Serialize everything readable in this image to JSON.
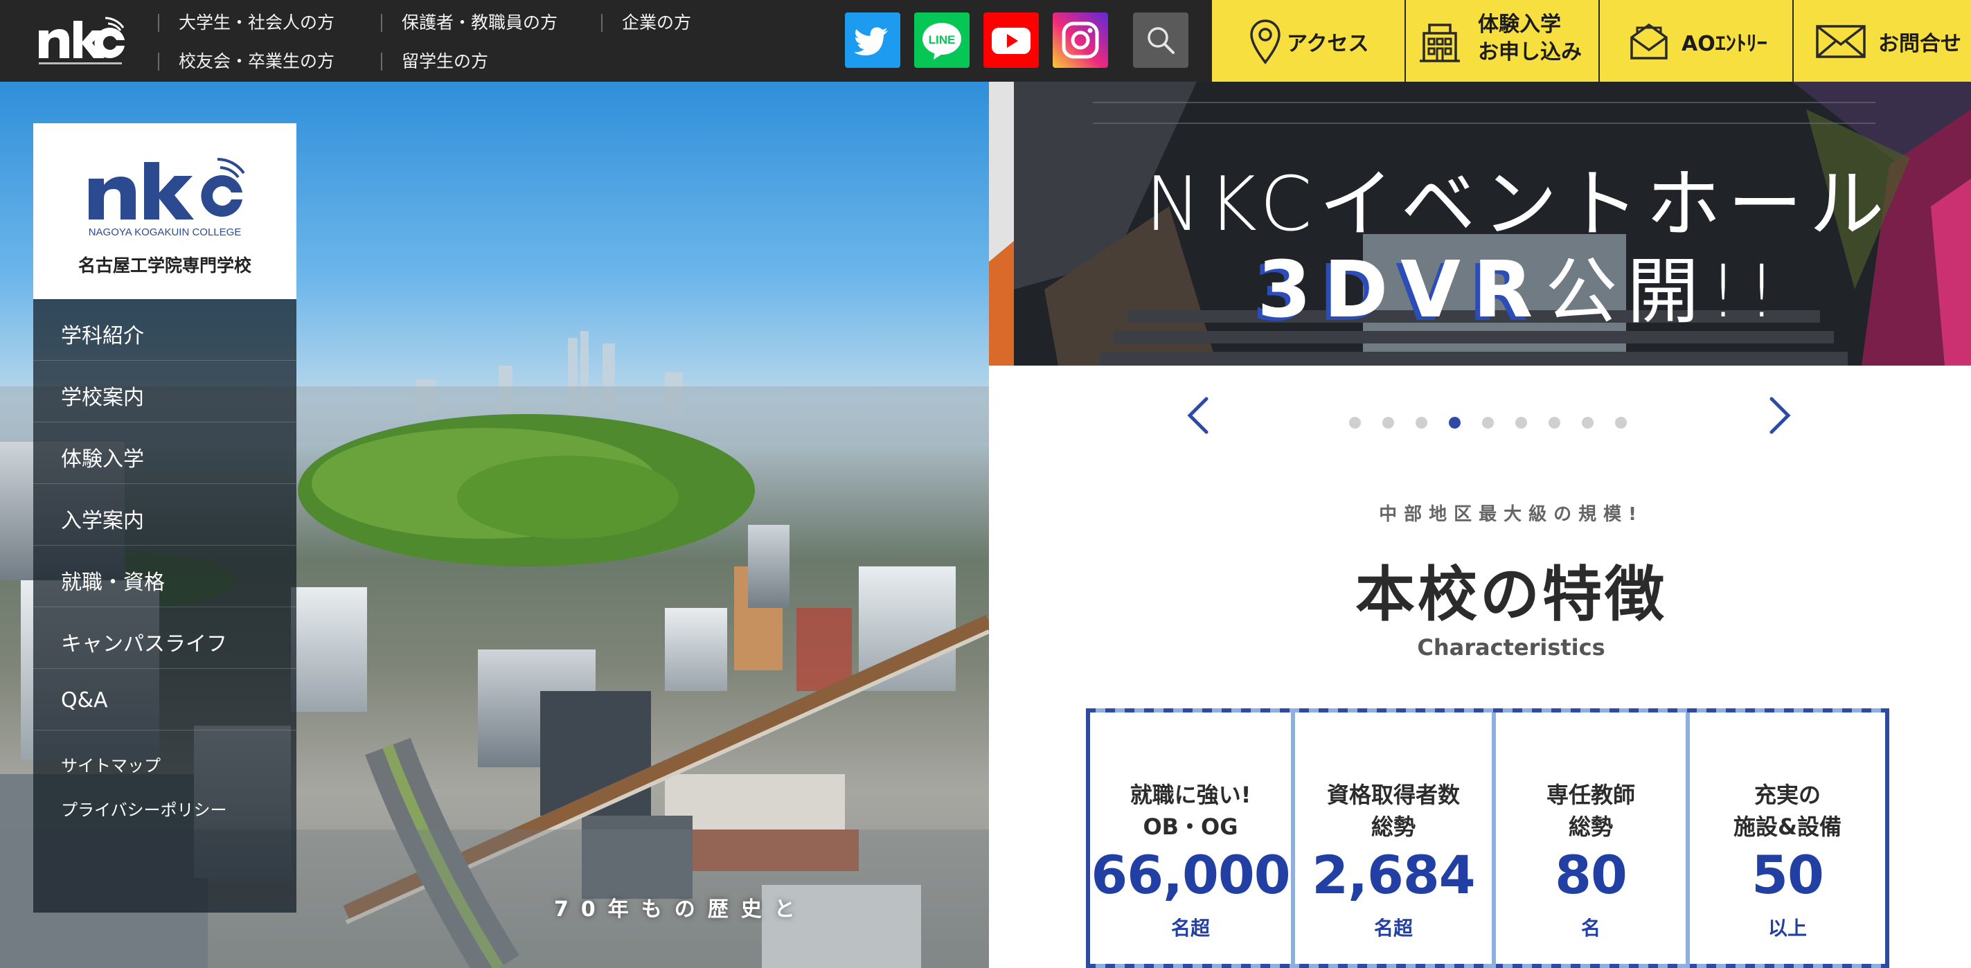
{
  "header": {
    "logo_alt": "NKC",
    "audience_links": [
      {
        "label": "大学生・社会人の方"
      },
      {
        "label": "保護者・教職員の方"
      },
      {
        "label": "企業の方"
      },
      {
        "label": "校友会・卒業生の方"
      },
      {
        "label": "留学生の方"
      }
    ],
    "social": {
      "twitter": "twitter-icon",
      "line": "LINE",
      "youtube": "youtube-icon",
      "instagram": "instagram-icon",
      "search": "search-icon"
    },
    "quick_links": [
      {
        "label": "アクセス",
        "icon": "map-pin-icon"
      },
      {
        "label_lines": [
          "体験入学",
          "お申し込み"
        ],
        "icon": "building-icon"
      },
      {
        "label": "AOｴﾝﾄﾘｰ",
        "icon": "envelope-open-icon"
      },
      {
        "label": "お問合せ",
        "icon": "mail-icon"
      }
    ],
    "colors": {
      "bar_bg": "#262626",
      "accent_yellow": "#f7df3f"
    }
  },
  "side_menu": {
    "logo_caption": "NAGOYA KOGAKUIN COLLEGE",
    "school_name": "名古屋工学院専門学校",
    "items": [
      {
        "label": "学科紹介"
      },
      {
        "label": "学校案内"
      },
      {
        "label": "体験入学"
      },
      {
        "label": "入学案内"
      },
      {
        "label": "就職・資格"
      },
      {
        "label": "キャンパスライフ"
      },
      {
        "label": "Q&A"
      }
    ],
    "sub_items": [
      {
        "label": "サイトマップ"
      },
      {
        "label": "プライバシーポリシー"
      }
    ]
  },
  "hero": {
    "caption": "70年もの歴史と"
  },
  "banner": {
    "line1": "NKCイベントホール",
    "line2_highlight": "3DVR",
    "line2_rest": "公開!!"
  },
  "slider": {
    "dot_count": 9,
    "active_index": 3,
    "accent": "#2f4aa5"
  },
  "features": {
    "eyebrow": "中部地区最大級の規模!",
    "title": "本校の特徴",
    "subtitle": "Characteristics",
    "stats": [
      {
        "label_lines": [
          "就職に強い!",
          "OB・OG"
        ],
        "value": "66,000",
        "unit": "名超"
      },
      {
        "label_lines": [
          "資格取得者数",
          "総勢"
        ],
        "value": "2,684",
        "unit": "名超"
      },
      {
        "label_lines": [
          "専任教師",
          "総勢"
        ],
        "value": "80",
        "unit": "名"
      },
      {
        "label_lines": [
          "充実の",
          "施設&設備"
        ],
        "value": "50",
        "unit": "以上"
      }
    ],
    "value_color": "#2240a3"
  }
}
